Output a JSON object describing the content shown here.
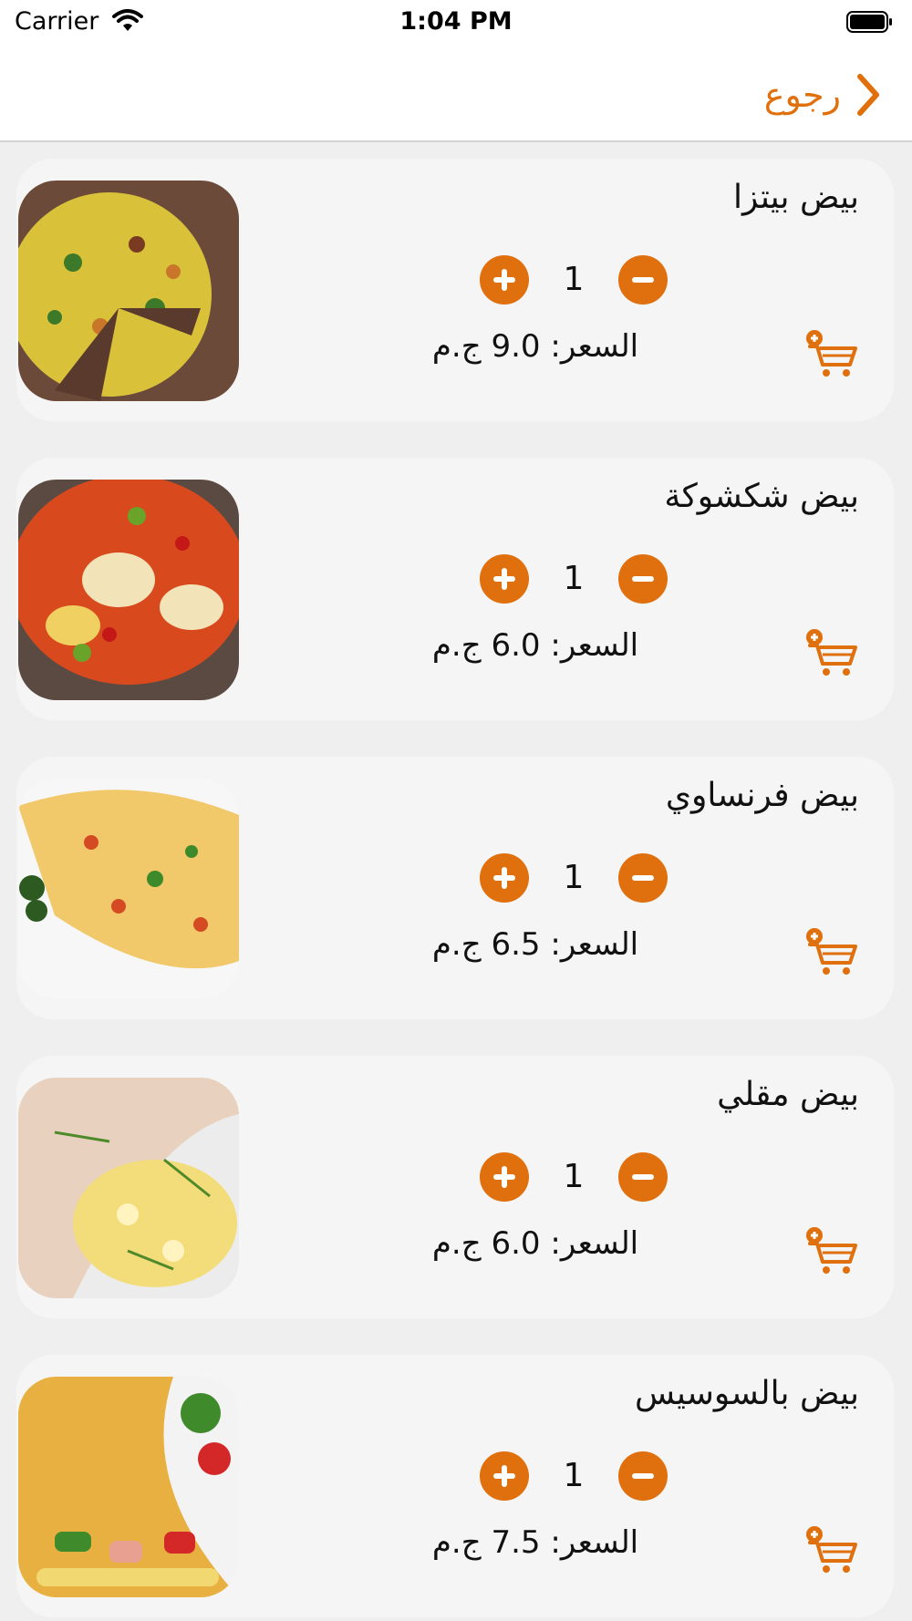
{
  "status_bar": {
    "carrier": "Carrier",
    "time": "1:04 PM"
  },
  "nav": {
    "back_label": "رجوع"
  },
  "accent_color": "#e0700d",
  "items": [
    {
      "name": "بيض بيتزا",
      "quantity": "1",
      "price": "السعر: 9.0 ج.م",
      "image": "pizza-omelette-photo"
    },
    {
      "name": "بيض شكشوكة",
      "quantity": "1",
      "price": "السعر: 6.0 ج.م",
      "image": "shakshuka-photo"
    },
    {
      "name": "بيض فرنساوي",
      "quantity": "1",
      "price": "السعر: 6.5 ج.م",
      "image": "french-omelette-photo"
    },
    {
      "name": "بيض مقلي",
      "quantity": "1",
      "price": "السعر: 6.0 ج.م",
      "image": "scrambled-eggs-pita-photo"
    },
    {
      "name": "بيض بالسوسيس",
      "quantity": "1",
      "price": "السعر: 7.5 ج.م",
      "image": "sausage-omelette-photo"
    }
  ]
}
